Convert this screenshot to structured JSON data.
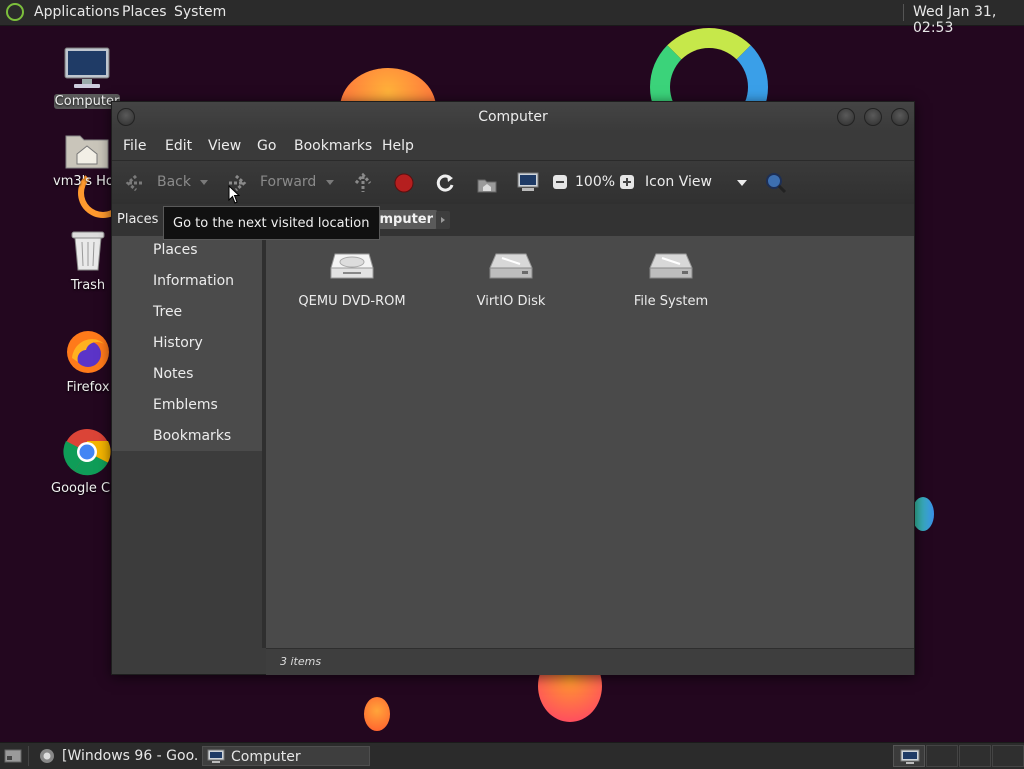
{
  "top_panel": {
    "menus": [
      "Applications",
      "Places",
      "System"
    ],
    "clock": "Wed Jan 31, 02:53"
  },
  "desktop_icons": [
    {
      "label": "Computer",
      "icon": "computer-icon"
    },
    {
      "label": "vm3's Home",
      "icon": "home-folder-icon"
    },
    {
      "label": "Trash",
      "icon": "trash-icon"
    },
    {
      "label": "Firefox",
      "icon": "firefox-icon"
    },
    {
      "label": "Google Chrome",
      "icon": "chrome-icon"
    }
  ],
  "window": {
    "title": "Computer",
    "menus": [
      "File",
      "Edit",
      "View",
      "Go",
      "Bookmarks",
      "Help"
    ],
    "toolbar": {
      "back_label": "Back",
      "forward_label": "Forward",
      "zoom": "100%",
      "view_mode": "Icon View"
    },
    "pathbar": {
      "side_label": "Places",
      "current": "Computer"
    },
    "tooltip": "Go to the next visited location",
    "sidebar_menu": [
      "Places",
      "Information",
      "Tree",
      "History",
      "Notes",
      "Emblems",
      "Bookmarks"
    ],
    "items": [
      {
        "label": "QEMU DVD-ROM",
        "icon": "optical-drive-icon"
      },
      {
        "label": "VirtIO Disk",
        "icon": "hard-disk-icon"
      },
      {
        "label": "File System",
        "icon": "hard-disk-icon"
      }
    ],
    "status": "3 items"
  },
  "taskbar": {
    "tasks": [
      "[Windows 96 - Goo...",
      "Computer"
    ]
  },
  "colors": {
    "desktop_bg": "#23071f",
    "panel_bg": "#2b2b2b",
    "window_bg": "#3c3c3c",
    "content_bg": "#4a4a4a"
  }
}
